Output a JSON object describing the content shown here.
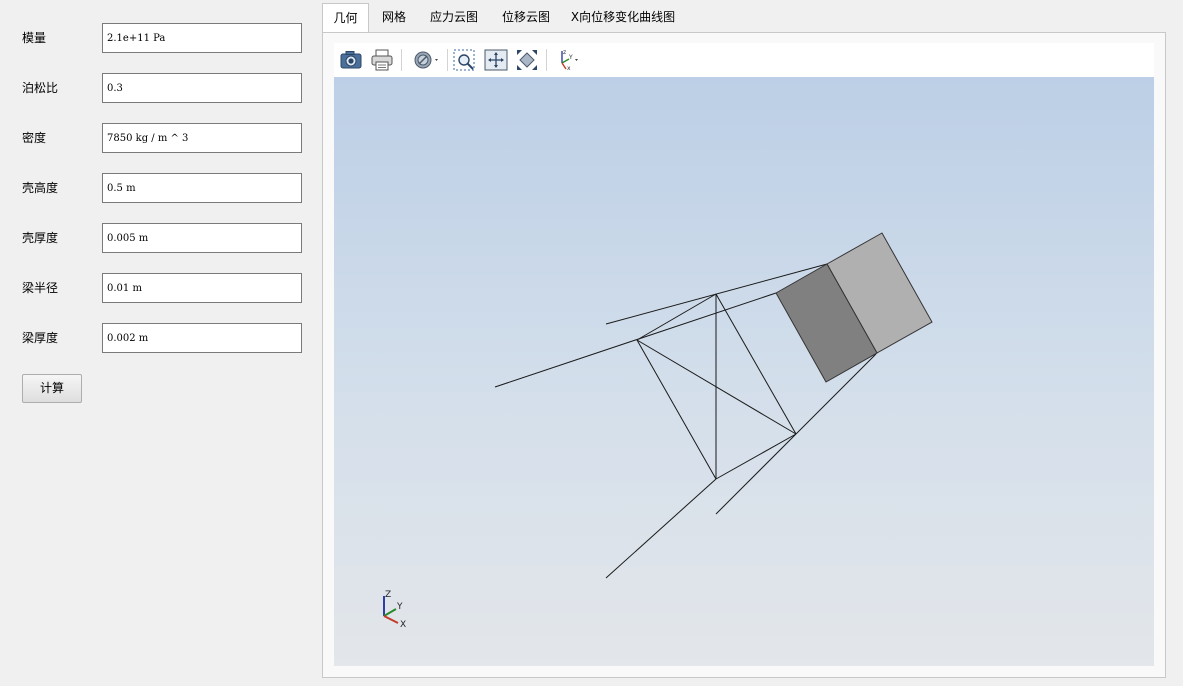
{
  "form": {
    "fields": [
      {
        "label": "模量",
        "value": "2.1e+11 Pa"
      },
      {
        "label": "泊松比",
        "value": "0.3"
      },
      {
        "label": "密度",
        "value": "7850 kg / m ^ 3"
      },
      {
        "label": "壳高度",
        "value": "0.5 m"
      },
      {
        "label": "壳厚度",
        "value": "0.005 m"
      },
      {
        "label": "梁半径",
        "value": "0.01 m"
      },
      {
        "label": "梁厚度",
        "value": "0.002 m"
      }
    ],
    "calc_button": "计算"
  },
  "tabs": [
    {
      "label": "几何",
      "active": true
    },
    {
      "label": "网格",
      "active": false
    },
    {
      "label": "应力云图",
      "active": false
    },
    {
      "label": "位移云图",
      "active": false
    },
    {
      "label": "X向位移变化曲线图",
      "active": false
    }
  ],
  "toolbar": {
    "icons": [
      "camera-icon",
      "print-icon",
      "display-mode-icon",
      "zoom-box-icon",
      "fit-all-icon",
      "zoom-extents-icon",
      "axis-orientation-icon"
    ]
  },
  "scene": {
    "background_top": "#bccfe6",
    "background_bottom": "#e3e6ea",
    "line_color": "#1a1a1a",
    "shell_dark_color": "#808080",
    "shell_light_color": "#b0b0b0",
    "triad_labels": {
      "z": "Z",
      "y": "Y",
      "x": "X"
    }
  }
}
